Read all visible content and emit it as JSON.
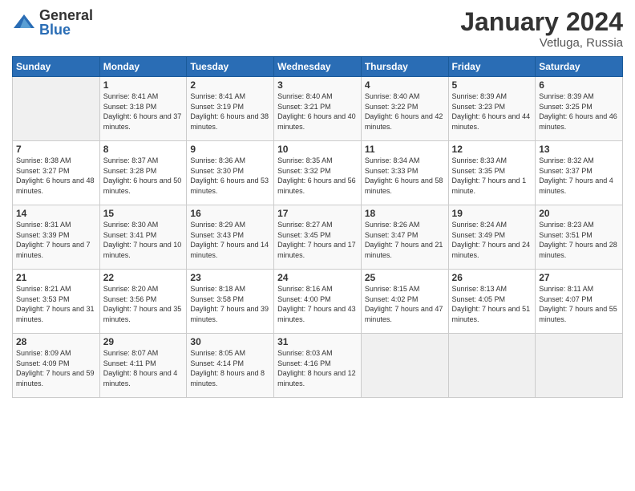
{
  "logo": {
    "general": "General",
    "blue": "Blue"
  },
  "title": "January 2024",
  "location": "Vetluga, Russia",
  "days_header": [
    "Sunday",
    "Monday",
    "Tuesday",
    "Wednesday",
    "Thursday",
    "Friday",
    "Saturday"
  ],
  "weeks": [
    [
      {
        "day": "",
        "sunrise": "",
        "sunset": "",
        "daylight": ""
      },
      {
        "day": "1",
        "sunrise": "Sunrise: 8:41 AM",
        "sunset": "Sunset: 3:18 PM",
        "daylight": "Daylight: 6 hours and 37 minutes."
      },
      {
        "day": "2",
        "sunrise": "Sunrise: 8:41 AM",
        "sunset": "Sunset: 3:19 PM",
        "daylight": "Daylight: 6 hours and 38 minutes."
      },
      {
        "day": "3",
        "sunrise": "Sunrise: 8:40 AM",
        "sunset": "Sunset: 3:21 PM",
        "daylight": "Daylight: 6 hours and 40 minutes."
      },
      {
        "day": "4",
        "sunrise": "Sunrise: 8:40 AM",
        "sunset": "Sunset: 3:22 PM",
        "daylight": "Daylight: 6 hours and 42 minutes."
      },
      {
        "day": "5",
        "sunrise": "Sunrise: 8:39 AM",
        "sunset": "Sunset: 3:23 PM",
        "daylight": "Daylight: 6 hours and 44 minutes."
      },
      {
        "day": "6",
        "sunrise": "Sunrise: 8:39 AM",
        "sunset": "Sunset: 3:25 PM",
        "daylight": "Daylight: 6 hours and 46 minutes."
      }
    ],
    [
      {
        "day": "7",
        "sunrise": "Sunrise: 8:38 AM",
        "sunset": "Sunset: 3:27 PM",
        "daylight": "Daylight: 6 hours and 48 minutes."
      },
      {
        "day": "8",
        "sunrise": "Sunrise: 8:37 AM",
        "sunset": "Sunset: 3:28 PM",
        "daylight": "Daylight: 6 hours and 50 minutes."
      },
      {
        "day": "9",
        "sunrise": "Sunrise: 8:36 AM",
        "sunset": "Sunset: 3:30 PM",
        "daylight": "Daylight: 6 hours and 53 minutes."
      },
      {
        "day": "10",
        "sunrise": "Sunrise: 8:35 AM",
        "sunset": "Sunset: 3:32 PM",
        "daylight": "Daylight: 6 hours and 56 minutes."
      },
      {
        "day": "11",
        "sunrise": "Sunrise: 8:34 AM",
        "sunset": "Sunset: 3:33 PM",
        "daylight": "Daylight: 6 hours and 58 minutes."
      },
      {
        "day": "12",
        "sunrise": "Sunrise: 8:33 AM",
        "sunset": "Sunset: 3:35 PM",
        "daylight": "Daylight: 7 hours and 1 minute."
      },
      {
        "day": "13",
        "sunrise": "Sunrise: 8:32 AM",
        "sunset": "Sunset: 3:37 PM",
        "daylight": "Daylight: 7 hours and 4 minutes."
      }
    ],
    [
      {
        "day": "14",
        "sunrise": "Sunrise: 8:31 AM",
        "sunset": "Sunset: 3:39 PM",
        "daylight": "Daylight: 7 hours and 7 minutes."
      },
      {
        "day": "15",
        "sunrise": "Sunrise: 8:30 AM",
        "sunset": "Sunset: 3:41 PM",
        "daylight": "Daylight: 7 hours and 10 minutes."
      },
      {
        "day": "16",
        "sunrise": "Sunrise: 8:29 AM",
        "sunset": "Sunset: 3:43 PM",
        "daylight": "Daylight: 7 hours and 14 minutes."
      },
      {
        "day": "17",
        "sunrise": "Sunrise: 8:27 AM",
        "sunset": "Sunset: 3:45 PM",
        "daylight": "Daylight: 7 hours and 17 minutes."
      },
      {
        "day": "18",
        "sunrise": "Sunrise: 8:26 AM",
        "sunset": "Sunset: 3:47 PM",
        "daylight": "Daylight: 7 hours and 21 minutes."
      },
      {
        "day": "19",
        "sunrise": "Sunrise: 8:24 AM",
        "sunset": "Sunset: 3:49 PM",
        "daylight": "Daylight: 7 hours and 24 minutes."
      },
      {
        "day": "20",
        "sunrise": "Sunrise: 8:23 AM",
        "sunset": "Sunset: 3:51 PM",
        "daylight": "Daylight: 7 hours and 28 minutes."
      }
    ],
    [
      {
        "day": "21",
        "sunrise": "Sunrise: 8:21 AM",
        "sunset": "Sunset: 3:53 PM",
        "daylight": "Daylight: 7 hours and 31 minutes."
      },
      {
        "day": "22",
        "sunrise": "Sunrise: 8:20 AM",
        "sunset": "Sunset: 3:56 PM",
        "daylight": "Daylight: 7 hours and 35 minutes."
      },
      {
        "day": "23",
        "sunrise": "Sunrise: 8:18 AM",
        "sunset": "Sunset: 3:58 PM",
        "daylight": "Daylight: 7 hours and 39 minutes."
      },
      {
        "day": "24",
        "sunrise": "Sunrise: 8:16 AM",
        "sunset": "Sunset: 4:00 PM",
        "daylight": "Daylight: 7 hours and 43 minutes."
      },
      {
        "day": "25",
        "sunrise": "Sunrise: 8:15 AM",
        "sunset": "Sunset: 4:02 PM",
        "daylight": "Daylight: 7 hours and 47 minutes."
      },
      {
        "day": "26",
        "sunrise": "Sunrise: 8:13 AM",
        "sunset": "Sunset: 4:05 PM",
        "daylight": "Daylight: 7 hours and 51 minutes."
      },
      {
        "day": "27",
        "sunrise": "Sunrise: 8:11 AM",
        "sunset": "Sunset: 4:07 PM",
        "daylight": "Daylight: 7 hours and 55 minutes."
      }
    ],
    [
      {
        "day": "28",
        "sunrise": "Sunrise: 8:09 AM",
        "sunset": "Sunset: 4:09 PM",
        "daylight": "Daylight: 7 hours and 59 minutes."
      },
      {
        "day": "29",
        "sunrise": "Sunrise: 8:07 AM",
        "sunset": "Sunset: 4:11 PM",
        "daylight": "Daylight: 8 hours and 4 minutes."
      },
      {
        "day": "30",
        "sunrise": "Sunrise: 8:05 AM",
        "sunset": "Sunset: 4:14 PM",
        "daylight": "Daylight: 8 hours and 8 minutes."
      },
      {
        "day": "31",
        "sunrise": "Sunrise: 8:03 AM",
        "sunset": "Sunset: 4:16 PM",
        "daylight": "Daylight: 8 hours and 12 minutes."
      },
      {
        "day": "",
        "sunrise": "",
        "sunset": "",
        "daylight": ""
      },
      {
        "day": "",
        "sunrise": "",
        "sunset": "",
        "daylight": ""
      },
      {
        "day": "",
        "sunrise": "",
        "sunset": "",
        "daylight": ""
      }
    ]
  ]
}
